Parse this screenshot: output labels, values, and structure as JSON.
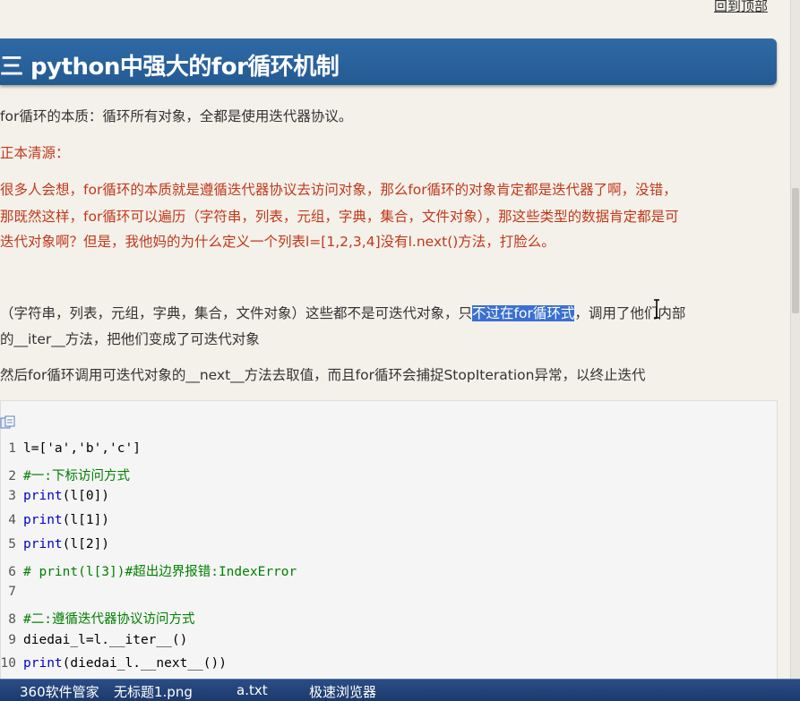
{
  "nav": {
    "back_to_top": "回到顶部"
  },
  "section": {
    "title": "三 python中强大的for循环机制"
  },
  "body": {
    "p1": "for循环的本质：循环所有对象，全都是使用迭代器协议。",
    "p2": "正本清源：",
    "p3_line1": "很多人会想，for循环的本质就是遵循迭代器协议去访问对象，那么for循环的对象肯定都是迭代器了啊，没错，",
    "p3_line2": "那既然这样，for循环可以遍历（字符串，列表，元组，字典，集合，文件对象），那这些类型的数据肯定都是可",
    "p3_line3": "迭代对象啊？但是，我他妈的为什么定义一个列表l=[1,2,3,4]没有l.next()方法，打脸么。",
    "p4_line1_pre": "（字符串，列表，元组，字典，集合，文件对象）这些都不是可迭代对象，只",
    "p4_line1_sel": "不过在for循环式",
    "p4_line1_post": "，调用了他们内部",
    "p4_line2": "的__iter__方法，把他们变成了可迭代对象",
    "p5": "然后for循环调用可迭代对象的__next__方法去取值，而且for循环会捕捉StopIteration异常，以终止迭代"
  },
  "code": {
    "lines": [
      {
        "n": "1",
        "segs": [
          {
            "t": "l=['a','b','c']",
            "c": "default"
          }
        ]
      },
      {
        "n": "2",
        "segs": [
          {
            "t": "#一:下标访问方式",
            "c": "comment"
          }
        ]
      },
      {
        "n": "3",
        "segs": [
          {
            "t": "print",
            "c": "kw"
          },
          {
            "t": "(l[0])",
            "c": "default"
          }
        ]
      },
      {
        "n": "4",
        "segs": [
          {
            "t": "print",
            "c": "kw"
          },
          {
            "t": "(l[1])",
            "c": "default"
          }
        ]
      },
      {
        "n": "5",
        "segs": [
          {
            "t": "print",
            "c": "kw"
          },
          {
            "t": "(l[2])",
            "c": "default"
          }
        ]
      },
      {
        "n": "6",
        "segs": [
          {
            "t": "# print(l[3])#超出边界报错:IndexError",
            "c": "comment"
          }
        ]
      },
      {
        "n": "7",
        "segs": [
          {
            "t": "",
            "c": "default"
          }
        ]
      },
      {
        "n": "8",
        "segs": [
          {
            "t": "#二:遵循迭代器协议访问方式",
            "c": "comment"
          }
        ]
      },
      {
        "n": "9",
        "segs": [
          {
            "t": "diedai_l=l.__iter__()",
            "c": "default"
          }
        ]
      },
      {
        "n": "10",
        "segs": [
          {
            "t": "print",
            "c": "kw"
          },
          {
            "t": "(diedai_l.__next__())",
            "c": "default"
          }
        ]
      }
    ]
  },
  "taskbar": {
    "items": [
      "360软件管家",
      "无标题1.png",
      "a.txt",
      "极速浏览器"
    ]
  },
  "colors": {
    "title_bg": "#2f6aa6",
    "red_text": "#c0391b",
    "selection": "#3a70d0",
    "taskbar_bg": "#1b3a6c"
  }
}
